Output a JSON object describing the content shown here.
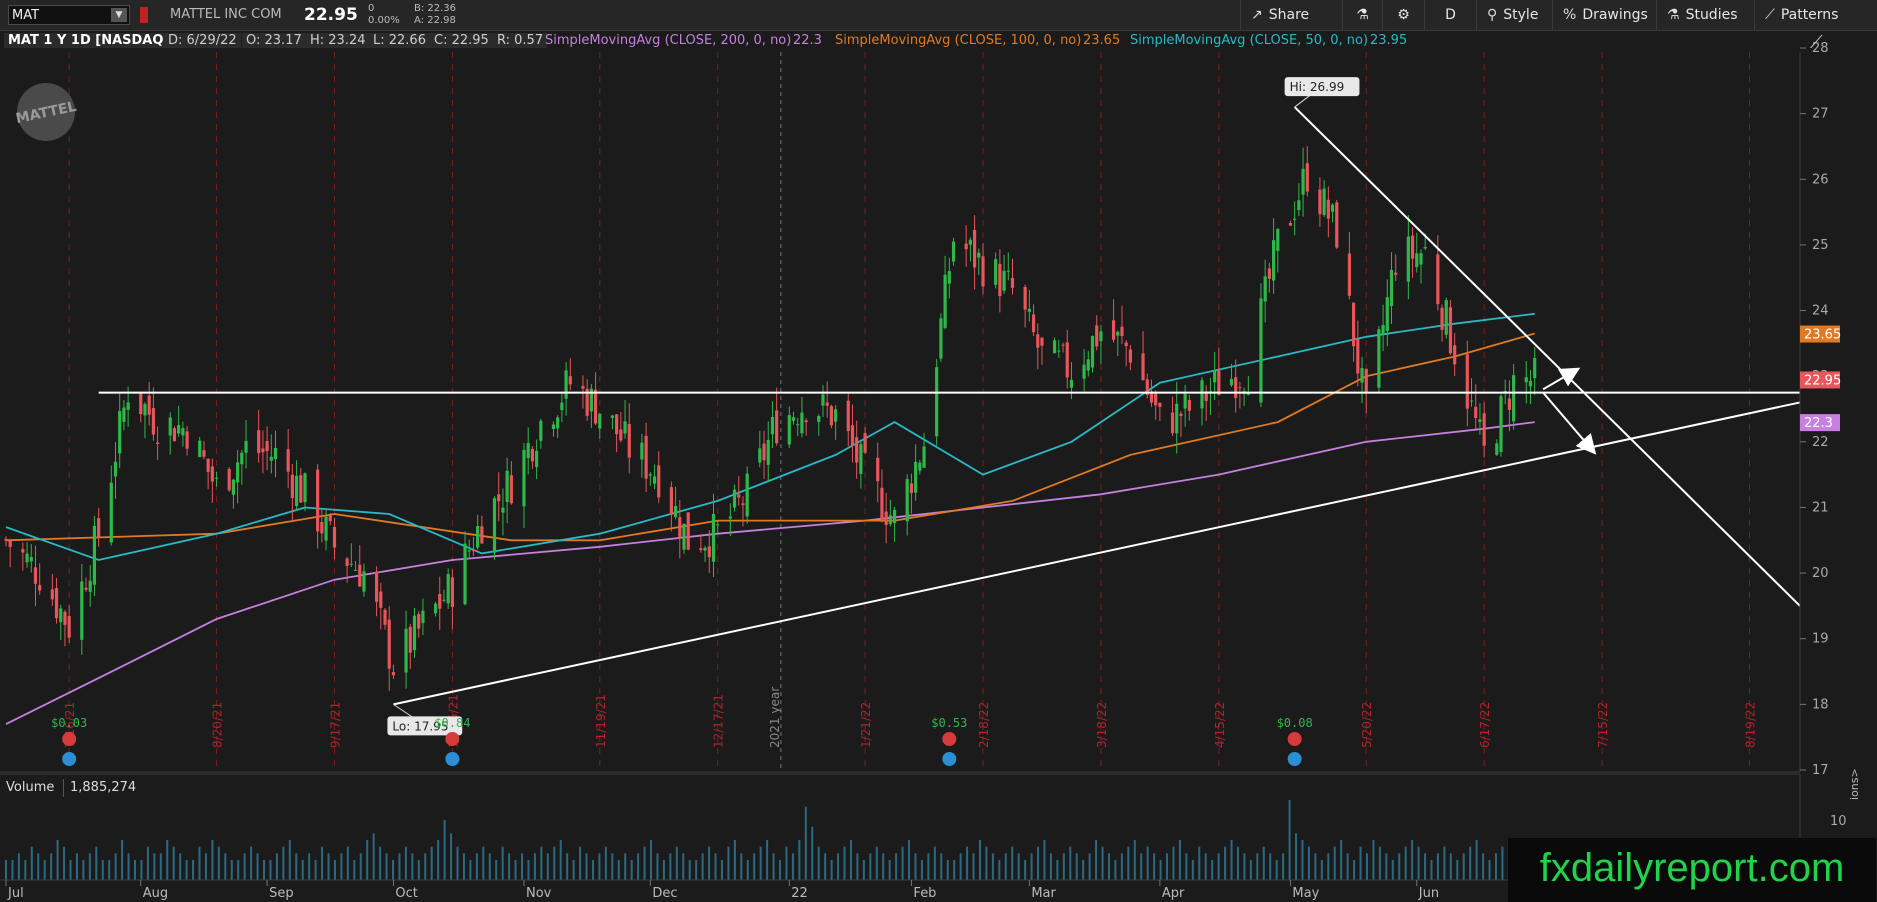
{
  "toolbar": {
    "symbol": "MAT",
    "company": "MATTEL INC COM",
    "last": "22.95",
    "change": "0",
    "change_pct": "0.00%",
    "bid": "B: 22.36",
    "ask": "A: 22.98",
    "share": "Share",
    "aggregation": "D",
    "style": "Style",
    "drawings": "Drawings",
    "studies": "Studies",
    "patterns": "Patterns"
  },
  "study_bar": {
    "instrument": "MAT 1 Y 1D [NASDAQ]",
    "date": "D: 6/29/22",
    "open": "O: 23.17",
    "high": "H: 23.24",
    "low": "L: 22.66",
    "close": "C: 22.95",
    "range": "R: 0.57",
    "sma200_label": "SimpleMovingAvg (CLOSE, 200, 0, no)",
    "sma200_value": "22.3",
    "sma100_label": "SimpleMovingAvg (CLOSE, 100, 0, no)",
    "sma100_value": "23.65",
    "sma50_label": "SimpleMovingAvg (CLOSE, 50, 0, no)",
    "sma50_value": "23.95"
  },
  "colors": {
    "up": "#2fb84a",
    "down": "#e8555a",
    "sma200": "#c77fe0",
    "sma100": "#e07a22",
    "sma50": "#29b9c6",
    "annotation": "#ffffff",
    "event_grid": "#7a1f1f",
    "date_text": "#b5222a"
  },
  "logo_text": "MATTEL",
  "chart_data": {
    "type": "candlestick",
    "ylim": [
      17,
      28
    ],
    "y_ticks": [
      "17",
      "18",
      "19",
      "20",
      "21",
      "22",
      "23",
      "24",
      "25",
      "26",
      "27",
      "28"
    ],
    "x_months": [
      "Jul",
      "Aug",
      "Sep",
      "Oct",
      "Nov",
      "Dec",
      "22",
      "Feb",
      "Mar",
      "Apr",
      "May",
      "Jun",
      "Ju"
    ],
    "vertical_dates": [
      "7/16/21",
      "8/20/21",
      "9/17/21",
      "10/15/21",
      "11/19/21",
      "12/17/21",
      "1/21/22",
      "2/18/22",
      "3/18/22",
      "4/15/22",
      "5/20/22",
      "6/17/22",
      "7/15/22",
      "8/19/22"
    ],
    "year_marker": "2021 year",
    "hi_label": "Hi: 26.99",
    "lo_label": "Lo: 17.95",
    "dividends": [
      {
        "label": "$0.03",
        "date": "7/16/21"
      },
      {
        "label": "$0.84",
        "date": "10/15/21"
      },
      {
        "label": "$0.53",
        "date": "2/10/22"
      },
      {
        "label": "$0.08",
        "date": "5/3/22"
      }
    ],
    "price_badges": [
      {
        "label": "23.65",
        "value": 23.65,
        "color": "#e07a22"
      },
      {
        "label": "22.95",
        "value": 22.95,
        "color": "#e8555a"
      },
      {
        "label": "22.3",
        "value": 22.3,
        "color": "#c77fe0"
      }
    ],
    "price_path": [
      [
        "7/1/21",
        20.5
      ],
      [
        "7/9/21",
        20.0
      ],
      [
        "7/16/21",
        19.2
      ],
      [
        "7/23/21",
        20.6
      ],
      [
        "7/30/21",
        22.8
      ],
      [
        "8/6/21",
        22.3
      ],
      [
        "8/13/21",
        22.2
      ],
      [
        "8/20/21",
        21.3
      ],
      [
        "8/27/21",
        21.9
      ],
      [
        "9/3/21",
        21.8
      ],
      [
        "9/10/21",
        21.2
      ],
      [
        "9/17/21",
        20.4
      ],
      [
        "9/24/21",
        20.0
      ],
      [
        "10/1/21",
        18.6
      ],
      [
        "10/8/21",
        19.2
      ],
      [
        "10/15/21",
        19.8
      ],
      [
        "10/22/21",
        20.8
      ],
      [
        "10/29/21",
        21.4
      ],
      [
        "11/5/21",
        22.3
      ],
      [
        "11/12/21",
        22.9
      ],
      [
        "11/19/21",
        22.5
      ],
      [
        "11/26/21",
        21.9
      ],
      [
        "12/3/21",
        21.5
      ],
      [
        "12/10/21",
        20.5
      ],
      [
        "12/17/21",
        20.6
      ],
      [
        "12/24/21",
        21.2
      ],
      [
        "12/31/21",
        22.3
      ],
      [
        "1/7/22",
        22.6
      ],
      [
        "1/14/22",
        22.4
      ],
      [
        "1/21/22",
        21.5
      ],
      [
        "1/28/22",
        20.8
      ],
      [
        "2/4/22",
        22.0
      ],
      [
        "2/11/22",
        25.1
      ],
      [
        "2/18/22",
        24.7
      ],
      [
        "2/25/22",
        24.3
      ],
      [
        "3/4/22",
        23.3
      ],
      [
        "3/11/22",
        23.1
      ],
      [
        "3/18/22",
        23.7
      ],
      [
        "3/25/22",
        23.4
      ],
      [
        "4/1/22",
        22.3
      ],
      [
        "4/8/22",
        22.5
      ],
      [
        "4/15/22",
        22.9
      ],
      [
        "4/22/22",
        23.1
      ],
      [
        "4/29/22",
        25.0
      ],
      [
        "5/6/22",
        26.1
      ],
      [
        "5/13/22",
        25.2
      ],
      [
        "5/20/22",
        22.4
      ],
      [
        "5/27/22",
        24.8
      ],
      [
        "6/3/22",
        24.9
      ],
      [
        "6/10/22",
        23.4
      ],
      [
        "6/17/22",
        21.8
      ],
      [
        "6/24/22",
        22.9
      ],
      [
        "6/29/22",
        22.95
      ]
    ],
    "sma50": [
      [
        "7/1/21",
        20.7
      ],
      [
        "7/23/21",
        20.2
      ],
      [
        "8/20/21",
        20.6
      ],
      [
        "9/10/21",
        21.0
      ],
      [
        "9/30/21",
        20.9
      ],
      [
        "10/22/21",
        20.3
      ],
      [
        "11/19/21",
        20.6
      ],
      [
        "12/17/21",
        21.1
      ],
      [
        "1/14/22",
        21.8
      ],
      [
        "1/28/22",
        22.3
      ],
      [
        "2/18/22",
        21.5
      ],
      [
        "3/11/22",
        22.0
      ],
      [
        "4/1/22",
        22.9
      ],
      [
        "4/29/22",
        23.3
      ],
      [
        "5/20/22",
        23.6
      ],
      [
        "6/10/22",
        23.8
      ],
      [
        "6/29/22",
        23.95
      ]
    ],
    "sma100": [
      [
        "7/1/21",
        20.5
      ],
      [
        "8/20/21",
        20.6
      ],
      [
        "9/17/21",
        20.9
      ],
      [
        "10/29/21",
        20.5
      ],
      [
        "11/19/21",
        20.5
      ],
      [
        "12/17/21",
        20.8
      ],
      [
        "1/28/22",
        20.8
      ],
      [
        "2/25/22",
        21.1
      ],
      [
        "3/25/22",
        21.8
      ],
      [
        "4/29/22",
        22.3
      ],
      [
        "5/20/22",
        23.0
      ],
      [
        "6/10/22",
        23.3
      ],
      [
        "6/29/22",
        23.65
      ]
    ],
    "sma200": [
      [
        "7/1/21",
        17.7
      ],
      [
        "7/23/21",
        18.4
      ],
      [
        "8/20/21",
        19.3
      ],
      [
        "9/17/21",
        19.9
      ],
      [
        "10/15/21",
        20.2
      ],
      [
        "11/19/21",
        20.4
      ],
      [
        "12/17/21",
        20.6
      ],
      [
        "1/21/22",
        20.8
      ],
      [
        "2/18/22",
        21.0
      ],
      [
        "3/18/22",
        21.2
      ],
      [
        "4/15/22",
        21.5
      ],
      [
        "5/20/22",
        22.0
      ],
      [
        "6/17/22",
        22.2
      ],
      [
        "6/29/22",
        22.3
      ]
    ],
    "annotation_lines": [
      {
        "name": "resistance-horizontal",
        "from": [
          "7/23/21",
          22.75
        ],
        "to": [
          "8/31/22",
          22.75
        ]
      },
      {
        "name": "support-trendline",
        "from": [
          "10/1/21",
          18.0
        ],
        "to": [
          "8/31/22",
          22.6
        ]
      },
      {
        "name": "downtrend-line",
        "from": [
          "5/3/22",
          27.1
        ],
        "to": [
          "8/31/22",
          19.5
        ]
      }
    ],
    "annotation_arrows": [
      {
        "name": "bullish-arrow",
        "from": [
          "7/1/22",
          22.8
        ],
        "to": [
          "7/9/22",
          23.1
        ]
      },
      {
        "name": "bearish-arrow",
        "from": [
          "7/1/22",
          22.75
        ],
        "to": [
          "7/13/22",
          21.85
        ]
      }
    ]
  },
  "volume": {
    "label": "Volume",
    "value": "1,885,274",
    "axis_label": "10",
    "bars": [
      3,
      3,
      4,
      3,
      5,
      4,
      3,
      4,
      6,
      5,
      3,
      4,
      3,
      4,
      5,
      3,
      3,
      4,
      6,
      4,
      3,
      3,
      5,
      4,
      4,
      6,
      5,
      4,
      3,
      3,
      5,
      4,
      6,
      5,
      4,
      3,
      3,
      4,
      5,
      4,
      3,
      3,
      4,
      5,
      6,
      4,
      3,
      4,
      3,
      5,
      4,
      3,
      4,
      5,
      3,
      4,
      6,
      7,
      5,
      4,
      3,
      4,
      5,
      4,
      3,
      4,
      5,
      6,
      9,
      7,
      5,
      4,
      3,
      4,
      5,
      4,
      3,
      5,
      4,
      3,
      4,
      3,
      4,
      5,
      4,
      5,
      6,
      4,
      3,
      5,
      4,
      3,
      4,
      5,
      4,
      3,
      4,
      3,
      4,
      5,
      6,
      4,
      3,
      4,
      5,
      4,
      3,
      3,
      4,
      5,
      4,
      3,
      5,
      6,
      4,
      3,
      4,
      5,
      6,
      4,
      3,
      5,
      4,
      6,
      11,
      8,
      5,
      4,
      3,
      4,
      5,
      6,
      4,
      3,
      4,
      5,
      4,
      3,
      4,
      5,
      6,
      4,
      3,
      4,
      5,
      4,
      3,
      3,
      4,
      5,
      4,
      6,
      5,
      4,
      3,
      4,
      5,
      4,
      3,
      4,
      5,
      6,
      4,
      3,
      4,
      5,
      4,
      3,
      4,
      6,
      5,
      4,
      3,
      4,
      5,
      6,
      4,
      5,
      4,
      3,
      4,
      5,
      6,
      4,
      3,
      5,
      4,
      3,
      4,
      5,
      6,
      5,
      4,
      3,
      4,
      5,
      4,
      3,
      4,
      12,
      7,
      6,
      5,
      4,
      3,
      4,
      5,
      6,
      4,
      3,
      5,
      4,
      6,
      5,
      4,
      3,
      4,
      5,
      6,
      5,
      4,
      3,
      4,
      5,
      4,
      3,
      4,
      5,
      6,
      4,
      3,
      4,
      5,
      6,
      4,
      3,
      4,
      5
    ]
  },
  "watermark": "fxdailyreport.com",
  "side_text": "ions>"
}
